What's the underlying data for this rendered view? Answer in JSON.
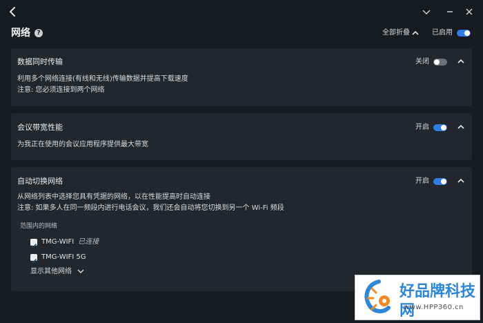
{
  "titlebar": {
    "back_icon": "back-arrow-icon",
    "minimize_icon": "chevron-down-icon",
    "close_icon": "close-icon"
  },
  "header": {
    "title": "网络",
    "help_glyph": "?",
    "collapse_all_label": "全部折叠",
    "enabled_label": "已启用",
    "enabled": true
  },
  "cards": [
    {
      "title": "数据同时传输",
      "state_label": "关闭",
      "enabled": false,
      "lines": [
        "利用多个网络连接(有线和无线)传输数据并提高下载速度",
        "注意: 您必须连接到两个网络"
      ]
    },
    {
      "title": "会议带宽性能",
      "state_label": "开启",
      "enabled": true,
      "lines": [
        "为我正在使用的会议应用程序提供最大带宽"
      ]
    },
    {
      "title": "自动切换网络",
      "state_label": "开启",
      "enabled": true,
      "lines": [
        "从网络列表中选择您具有凭据的网络，以在性能提高时自动连接",
        "注意: 如果多人在同一频段内进行电话会议，我们还会自动将您切换到另一个 Wi-Fi 频段"
      ],
      "networks_heading": "范围内的网络",
      "networks": [
        {
          "name": "TMG-WIFI",
          "status": "已连接",
          "checked": true
        },
        {
          "name": "TMG-WIFI 5G",
          "status": "",
          "checked": true
        }
      ],
      "show_more_label": "显示其他网络"
    }
  ],
  "watermark": {
    "brand": "好品牌科技网",
    "url": "www.HPP360.cn"
  },
  "colors": {
    "background": "#171b20",
    "card": "#22272d",
    "accent": "#2f7de1",
    "toggle_off": "#6a7078"
  }
}
